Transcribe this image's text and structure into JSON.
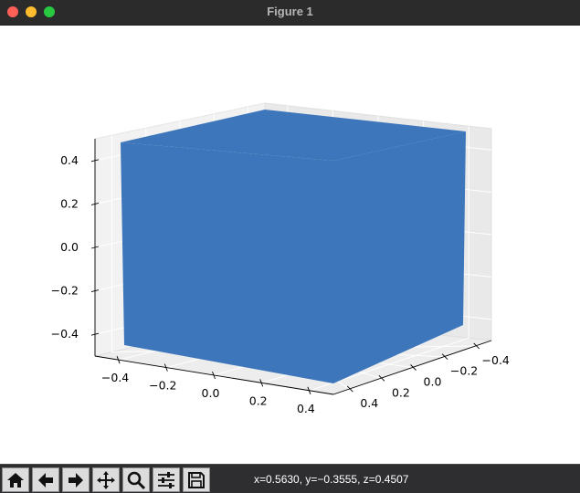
{
  "window": {
    "title": "Figure 1"
  },
  "toolbar": {
    "buttons": [
      {
        "name": "home-icon"
      },
      {
        "name": "back-arrow-icon"
      },
      {
        "name": "forward-arrow-icon"
      },
      {
        "name": "pan-move-icon"
      },
      {
        "name": "zoom-magnifier-icon"
      },
      {
        "name": "subplots-config-icon"
      },
      {
        "name": "save-floppy-icon"
      }
    ],
    "coordinates": "x=0.5630, y=−0.3555, z=0.4507"
  },
  "chart_data": {
    "type": "3d-surface",
    "shape": "cube",
    "face_color": "#3d76bb",
    "x_ticks": [
      "−0.4",
      "−0.2",
      "0.0",
      "0.2",
      "0.4"
    ],
    "y_ticks": [
      "−0.4",
      "−0.2",
      "0.0",
      "0.2",
      "0.4"
    ],
    "z_ticks": [
      "0.4",
      "0.2",
      "0.0",
      "−0.2",
      "−0.4"
    ],
    "xlim": [
      -0.5,
      0.5
    ],
    "ylim": [
      -0.5,
      0.5
    ],
    "zlim": [
      -0.5,
      0.5
    ],
    "grid": true
  }
}
